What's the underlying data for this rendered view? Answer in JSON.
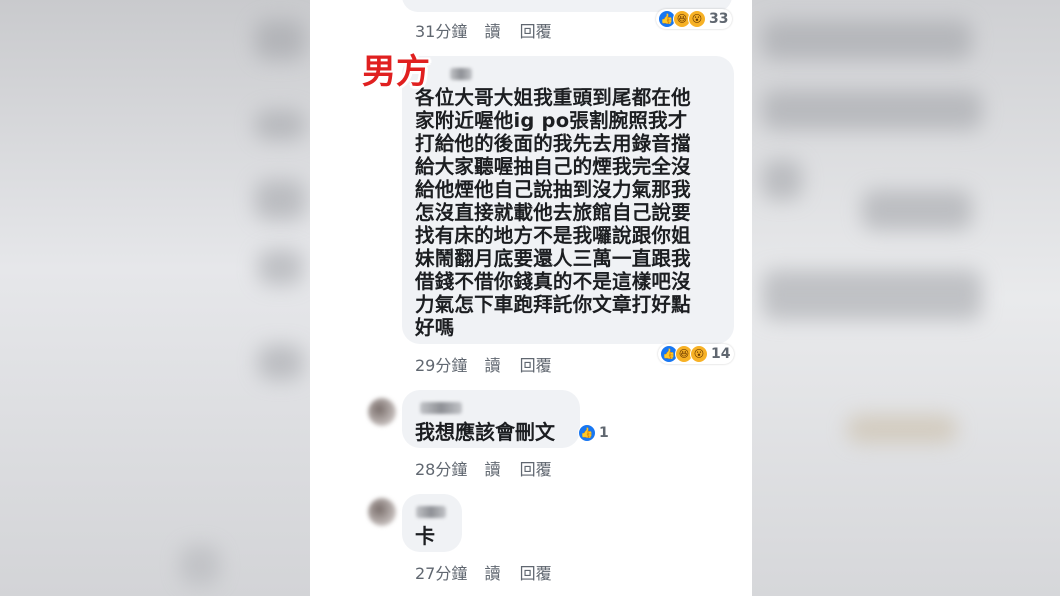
{
  "tag_label": "男方",
  "comments": [
    {
      "text": "",
      "time": "31分鐘",
      "read": "讀",
      "reply": "回覆",
      "reaction_count": "33"
    },
    {
      "text": "各位大哥大姐我重頭到尾都在他\n家附近喔他ig po張割腕照我才\n打給他的後面的我先去用錄音擋\n給大家聽喔抽自己的煙我完全沒\n給他煙他自己說抽到沒力氣那我\n怎沒直接就載他去旅館自己說要\n找有床的地方不是我囉說跟你姐\n妹鬧翻月底要還人三萬一直跟我\n借錢不借你錢真的不是這樣吧沒\n力氣怎下車跑拜託你文章打好點\n好嗎",
      "time": "29分鐘",
      "read": "讀",
      "reply": "回覆",
      "reaction_count": "14"
    },
    {
      "text": "我想應該會刪文",
      "time": "28分鐘",
      "read": "讀",
      "reply": "回覆",
      "reaction_count": "1"
    },
    {
      "text": "卡",
      "time": "27分鐘",
      "read": "讀",
      "reply": "回覆"
    }
  ],
  "colors": {
    "tag": "#e02020",
    "bubble": "#f0f2f5",
    "meta": "#606770",
    "like": "#1877f2"
  },
  "icons": [
    "like-icon",
    "haha-icon",
    "wow-icon"
  ]
}
